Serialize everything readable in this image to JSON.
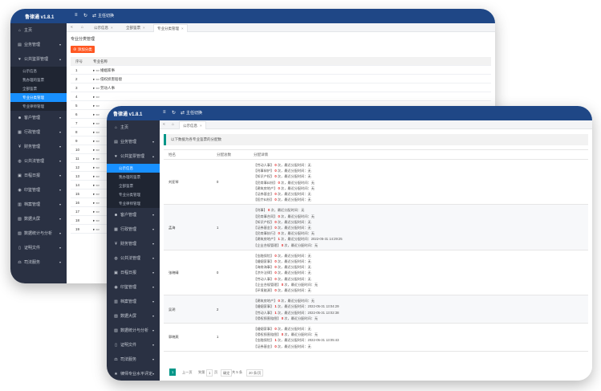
{
  "back_window": {
    "brand": "鲁律通 v1.8.1",
    "header_link": "主任切换",
    "sidebar": [
      {
        "label": "主页",
        "icon": "home-icon",
        "arrow": ""
      },
      {
        "label": "业务管理",
        "icon": "briefcase-icon",
        "arrow": "▾"
      },
      {
        "label": "公共鉴票管理",
        "icon": "heart-icon",
        "arrow": "▴"
      }
    ],
    "sub_items": [
      "公示信息",
      "我办理的鉴票",
      "全部鉴票",
      "专业分类管理",
      "专业律师管理"
    ],
    "sidebar_more": [
      {
        "label": "客户管理",
        "icon": "user-icon"
      },
      {
        "label": "行政管理",
        "icon": "building-icon"
      },
      {
        "label": "财务管理",
        "icon": "money-icon"
      },
      {
        "label": "公共法管理",
        "icon": "globe-icon"
      },
      {
        "label": "日程日报",
        "icon": "calendar-icon"
      },
      {
        "label": "印鉴管理",
        "icon": "stamp-icon"
      },
      {
        "label": "档案管理",
        "icon": "archive-icon"
      },
      {
        "label": "数据大屏",
        "icon": "chart-icon"
      },
      {
        "label": "数据统计与分析",
        "icon": "stats-icon"
      },
      {
        "label": "证明文件",
        "icon": "file-icon"
      },
      {
        "label": "司法服务",
        "icon": "law-icon"
      }
    ],
    "tabs": [
      "公示信息",
      "全部鉴票",
      "专业分类管理"
    ],
    "page_title": "专业分类管理",
    "add_button": "添加分类",
    "table_headers": [
      "序号",
      "专业名称"
    ],
    "rows": [
      {
        "no": "1",
        "name": "婚姻家事"
      },
      {
        "no": "2",
        "name": "侵权损害赔偿"
      },
      {
        "no": "3",
        "name": "劳动人事"
      },
      {
        "no": "4",
        "name": ""
      },
      {
        "no": "5",
        "name": ""
      },
      {
        "no": "6",
        "name": ""
      },
      {
        "no": "7",
        "name": ""
      },
      {
        "no": "8",
        "name": ""
      },
      {
        "no": "9",
        "name": ""
      },
      {
        "no": "10",
        "name": ""
      },
      {
        "no": "11",
        "name": ""
      },
      {
        "no": "12",
        "name": ""
      },
      {
        "no": "13",
        "name": ""
      },
      {
        "no": "14",
        "name": ""
      },
      {
        "no": "15",
        "name": ""
      },
      {
        "no": "16",
        "name": ""
      },
      {
        "no": "17",
        "name": ""
      },
      {
        "no": "18",
        "name": ""
      },
      {
        "no": "19",
        "name": ""
      }
    ]
  },
  "front_window": {
    "brand": "鲁律通 v1.8.1",
    "header_link": "主任切换",
    "sidebar": [
      {
        "label": "主页",
        "icon": "home-icon",
        "arrow": ""
      },
      {
        "label": "业务管理",
        "icon": "briefcase-icon",
        "arrow": "▾"
      },
      {
        "label": "公共鉴票管理",
        "icon": "heart-icon",
        "arrow": "▴"
      }
    ],
    "sub_items": [
      "公示信息",
      "我办理的鉴票",
      "全部鉴票",
      "专业分类管理",
      "专业律师管理"
    ],
    "sidebar_more": [
      {
        "label": "客户管理",
        "icon": "user-icon"
      },
      {
        "label": "行政管理",
        "icon": "building-icon"
      },
      {
        "label": "财务管理",
        "icon": "money-icon"
      },
      {
        "label": "公共法管理",
        "icon": "globe-icon"
      },
      {
        "label": "日程日报",
        "icon": "calendar-icon"
      },
      {
        "label": "印鉴管理",
        "icon": "stamp-icon"
      },
      {
        "label": "档案管理",
        "icon": "archive-icon"
      },
      {
        "label": "数据大屏",
        "icon": "chart-icon"
      },
      {
        "label": "数据统计与分析",
        "icon": "stats-icon"
      },
      {
        "label": "证明文件",
        "icon": "file-icon"
      },
      {
        "label": "司法服务",
        "icon": "law-icon"
      },
      {
        "label": "律师专业水平评定",
        "icon": "award-icon"
      },
      {
        "label": "工作台",
        "icon": "desk-icon"
      }
    ],
    "tabs": [
      "公示信息"
    ],
    "info_text": "以下数据为各专业鉴票的分配数",
    "table_headers": [
      "姓名",
      "分配总数",
      "分配详情"
    ],
    "rows": [
      {
        "name": "刘亚琴",
        "count": "0",
        "details": [
          {
            "cat": "【劳动人事】",
            "n": "0",
            "rest": "次，最近分配时间：无"
          },
          {
            "cat": "【刑事辩护】",
            "n": "0",
            "rest": "次，最近分配时间：无"
          },
          {
            "cat": "【知识产权】",
            "n": "0",
            "rest": "次，最近分配时间：无"
          },
          {
            "cat": "【民商事纠纷】",
            "n": "0",
            "rest": "次，最近分配时间：无"
          },
          {
            "cat": "【建筑房地产】",
            "n": "0",
            "rest": "次，最近分配时间：无"
          },
          {
            "cat": "【证券基金】",
            "n": "0",
            "rest": "次，最近分配时间：无"
          },
          {
            "cat": "【医疗纠纷】",
            "n": "0",
            "rest": "次，最近分配时间：无"
          }
        ]
      },
      {
        "name": "孟海",
        "count": "1",
        "details": [
          {
            "cat": "【刑事】",
            "n": "0",
            "rest": "次，最近分配时间：无"
          },
          {
            "cat": "【民商事合同】",
            "n": "0",
            "rest": "次，最近分配时间：无"
          },
          {
            "cat": "【知识产权】",
            "n": "0",
            "rest": "次，最近分配时间：无"
          },
          {
            "cat": "【证券基金】",
            "n": "0",
            "rest": "次，最近分配时间：无"
          },
          {
            "cat": "【民商事执行】",
            "n": "0",
            "rest": "次，最近分配时间：无"
          },
          {
            "cat": "【建筑房地产】",
            "n": "1",
            "rest": "次，最近分配时间：2022-05-31 14:29:25"
          },
          {
            "cat": "【企业合规管理】",
            "n": "0",
            "rest": "次，最近分配时间：无"
          }
        ]
      },
      {
        "name": "张晓晴",
        "count": "0",
        "details": [
          {
            "cat": "【金融保险】",
            "n": "0",
            "rest": "次，最近分配时间：无"
          },
          {
            "cat": "【婚姻家事】",
            "n": "0",
            "rest": "次，最近分配时间：无"
          },
          {
            "cat": "【海商海事】",
            "n": "0",
            "rest": "次，最近分配时间：无"
          },
          {
            "cat": "【涉外法律】",
            "n": "0",
            "rest": "次，最近分配时间：无"
          },
          {
            "cat": "【劳动人事】",
            "n": "0",
            "rest": "次，最近分配时间：无"
          },
          {
            "cat": "【企业合规管理】",
            "n": "0",
            "rest": "次，最近分配时间：无"
          },
          {
            "cat": "【环境能源】",
            "n": "0",
            "rest": "次，最近分配时间：无"
          }
        ]
      },
      {
        "name": "吴玥",
        "count": "2",
        "details": [
          {
            "cat": "【建筑房地产】",
            "n": "0",
            "rest": "次，最近分配时间：无"
          },
          {
            "cat": "【婚姻家事】",
            "n": "1",
            "rest": "次，最近分配时间：2022-05-31 13:04:29"
          },
          {
            "cat": "【劳动人事】",
            "n": "1",
            "rest": "次，最近分配时间：2022-05-31 13:02:38"
          },
          {
            "cat": "【侵权损害赔偿】",
            "n": "0",
            "rest": "次，最近分配时间：无"
          }
        ]
      },
      {
        "name": "郭晓燕",
        "count": "1",
        "details": [
          {
            "cat": "【婚姻家事】",
            "n": "0",
            "rest": "次，最近分配时间：无"
          },
          {
            "cat": "【侵权损害赔偿】",
            "n": "0",
            "rest": "次，最近分配时间：无"
          },
          {
            "cat": "【金融保险】",
            "n": "1",
            "rest": "次，最近分配时间：2022-05-31 13:05:43"
          },
          {
            "cat": "【证券基金】",
            "n": "0",
            "rest": "次，最近分配时间：无"
          }
        ]
      }
    ],
    "pager": {
      "prev": "上一页",
      "page": "1",
      "goto_label": "到第",
      "goto_value": "1",
      "page_unit": "页",
      "confirm": "确定",
      "total": "共 5 条",
      "per_page": "20 条/页"
    }
  },
  "icons": {
    "menu_toggle": "≡",
    "refresh": "↻",
    "switch": "⇄",
    "collapse": "«",
    "home": "⌂"
  },
  "colors": {
    "header": "#1f4786",
    "sidebar": "#2a3143",
    "active": "#1890ff",
    "accent_red": "#ff5722",
    "count_red": "#e02020",
    "teal": "#009688"
  }
}
